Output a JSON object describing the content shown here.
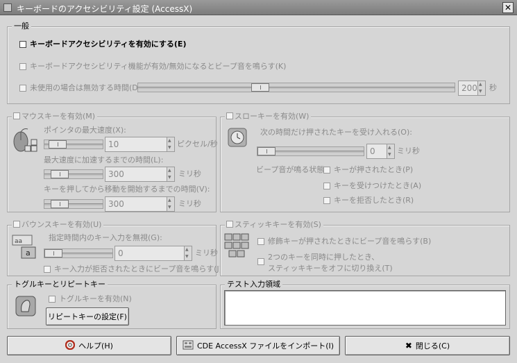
{
  "window": {
    "title": "キーボードのアクセシビリティ設定 (AccessX)",
    "close_glyph": "✕"
  },
  "general": {
    "frame_label": "一般",
    "enable_accessibility": "キーボードアクセシビリティを有効にする(E)",
    "beep_on_toggle": "キーボードアクセシビリティ機能が有効/無効になるとビープ音を鳴らす(K)",
    "disable_if_unused": "未使用の場合は無効する時間(D)",
    "timeout_value": "200",
    "timeout_unit": "秒",
    "timeout_level": 0.38
  },
  "mouse_keys": {
    "frame_label": "マウスキーを有効(M)",
    "max_speed_label": "ポインタの最大速度(X):",
    "max_speed_value": "10",
    "max_speed_unit": "ピクセル/秒",
    "max_speed_level": 0.1,
    "accel_label": "最大速度に加速するまでの時間(L):",
    "accel_value": "300",
    "accel_unit": "ミリ秒",
    "accel_level": 0.15,
    "delay_label": "キーを押してから移動を開始するまでの時間(V):",
    "delay_value": "300",
    "delay_unit": "ミリ秒",
    "delay_level": 0.15
  },
  "slow_keys": {
    "frame_label": "スローキーを有効(W)",
    "accept_label": "次の時間だけ押されたキーを受け入れる(O):",
    "accept_value": "0",
    "accept_unit": "ミリ秒",
    "accept_level": 0.0,
    "beep_when_label": "ビープ音が鳴る状態:",
    "on_press": "キーが押されたとき(P)",
    "on_accept": "キーを受けつけたとき(A)",
    "on_reject": "キーを拒否したとき(R)"
  },
  "bounce_keys": {
    "frame_label": "バウンスキーを有効(U)",
    "ignore_label": "指定時間内のキー入力を無視(G):",
    "ignore_value": "0",
    "ignore_unit": "ミリ秒",
    "ignore_level": 0.0,
    "beep_on_reject": "キー入力が拒否されたときにビープ音を鳴らす(J)"
  },
  "sticky_keys": {
    "frame_label": "スティッキキーを有効(S)",
    "beep_on_modifier": "修飾キーが押されたときにビープ音を鳴らす(B)",
    "two_keys_line1": "2つのキーを同時に押したとき、",
    "two_keys_line2": "スティッキキーをオフに切り換え(T)"
  },
  "toggle_repeat": {
    "frame_label": "トグルキーとリピートキー",
    "enable_toggle": "トグルキーを有効(N)",
    "repeat_settings_button": "リピートキーの設定(F)"
  },
  "test_area": {
    "frame_label": "テスト入力領域",
    "value": ""
  },
  "buttons": {
    "help": "ヘルプ(H)",
    "help_icon": "help-lifebuoy-icon",
    "import": "CDE AccessX ファイルをインポート(I)",
    "import_icon": "import-file-icon",
    "close": "閉じる(C)",
    "close_icon": "close-x-icon"
  },
  "colors": {
    "window_bg": "#d6d6d6",
    "titlebar": "#8a8a8a",
    "disabled_text": "#8a8a8a"
  }
}
